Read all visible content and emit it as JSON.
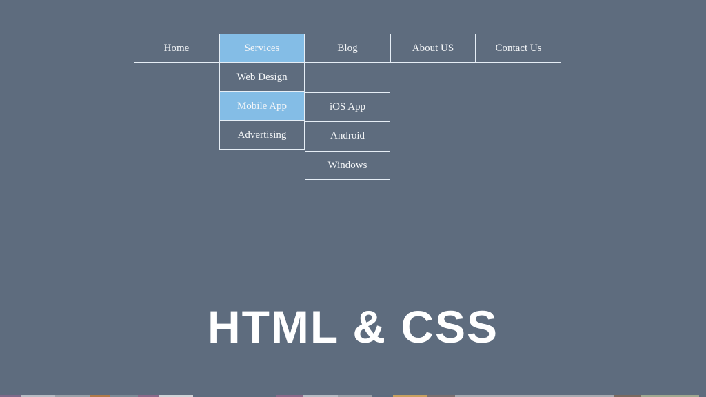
{
  "nav": {
    "items": [
      {
        "label": "Home",
        "active": false
      },
      {
        "label": "Services",
        "active": true
      },
      {
        "label": "Blog",
        "active": false
      },
      {
        "label": "About US",
        "active": false
      },
      {
        "label": "Contact Us",
        "active": false
      }
    ]
  },
  "services_dropdown": {
    "items": [
      {
        "label": "Web Design",
        "active": false
      },
      {
        "label": "Mobile App",
        "active": true
      },
      {
        "label": "Advertising",
        "active": false
      }
    ]
  },
  "mobile_app_submenu": {
    "items": [
      {
        "label": "iOS App"
      },
      {
        "label": "Android"
      },
      {
        "label": "Windows"
      }
    ]
  },
  "banner": {
    "title": "HTML & CSS"
  },
  "colors": {
    "background": "#5e6c7e",
    "active": "#84bde6",
    "border": "#e6eef6"
  }
}
